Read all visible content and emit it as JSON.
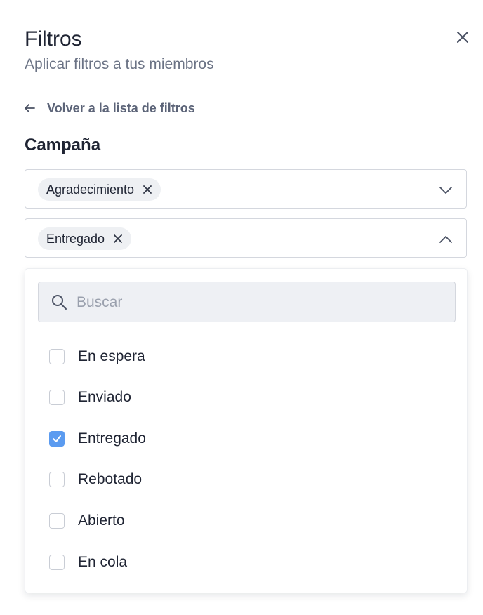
{
  "header": {
    "title": "Filtros",
    "subtitle": "Aplicar filtros a tus miembros"
  },
  "back_link": {
    "label": "Volver a la lista de filtros"
  },
  "section": {
    "title": "Campaña"
  },
  "selects": [
    {
      "chip_label": "Agradecimiento",
      "expanded": false
    },
    {
      "chip_label": "Entregado",
      "expanded": true
    }
  ],
  "search": {
    "placeholder": "Buscar",
    "value": ""
  },
  "options": [
    {
      "label": "En espera",
      "checked": false
    },
    {
      "label": "Enviado",
      "checked": false
    },
    {
      "label": "Entregado",
      "checked": true
    },
    {
      "label": "Rebotado",
      "checked": false
    },
    {
      "label": "Abierto",
      "checked": false
    },
    {
      "label": "En cola",
      "checked": false
    }
  ],
  "colors": {
    "accent": "#5b9bf0",
    "text": "#1f2433",
    "muted": "#6b7385",
    "border": "#d4d7de"
  },
  "icons": [
    "close-icon",
    "arrow-left-icon",
    "chevron-down-icon",
    "chevron-up-icon",
    "search-icon",
    "check-icon"
  ]
}
